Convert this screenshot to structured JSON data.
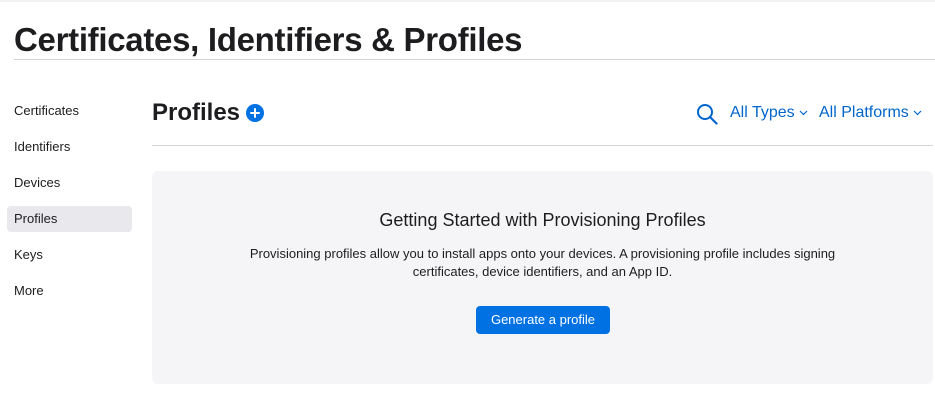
{
  "header": {
    "title": "Certificates, Identifiers & Profiles"
  },
  "sidebar": {
    "items": [
      {
        "label": "Certificates",
        "active": false
      },
      {
        "label": "Identifiers",
        "active": false
      },
      {
        "label": "Devices",
        "active": false
      },
      {
        "label": "Profiles",
        "active": true
      },
      {
        "label": "Keys",
        "active": false
      },
      {
        "label": "More",
        "active": false
      }
    ]
  },
  "main": {
    "title": "Profiles",
    "add_icon": "plus-circle-icon",
    "search_icon": "search-icon",
    "filters": {
      "types_label": "All Types",
      "platforms_label": "All Platforms"
    },
    "empty_state": {
      "title": "Getting Started with Provisioning Profiles",
      "description_line1": "Provisioning profiles allow you to install apps onto your devices. A provisioning profile includes signing",
      "description_line2": "certificates, device identifiers, and an App ID.",
      "button_label": "Generate a profile"
    }
  },
  "colors": {
    "accent": "#0071e3",
    "link": "#0066cc",
    "panel_background": "#f5f5f7",
    "active_item_background": "#e8e8ed"
  }
}
